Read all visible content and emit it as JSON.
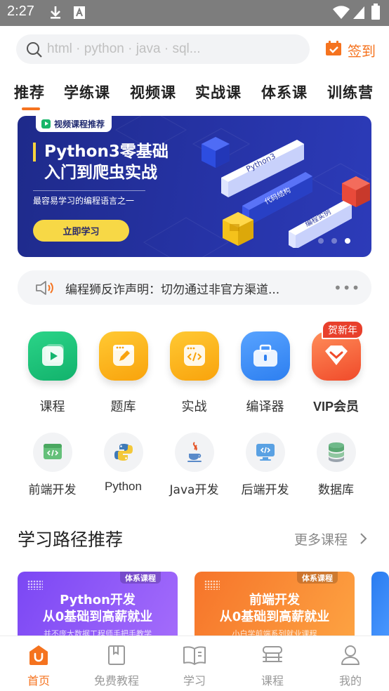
{
  "status_bar": {
    "time": "2:27",
    "icons": [
      "download-icon",
      "text-a-icon",
      "wifi-icon",
      "signal-icon",
      "battery-icon"
    ]
  },
  "search": {
    "placeholder": "html · python · java · sql..."
  },
  "checkin": {
    "label": "签到",
    "icon": "calendar-check-icon"
  },
  "tabs": [
    {
      "label": "推荐",
      "active": true
    },
    {
      "label": "学练课"
    },
    {
      "label": "视频课"
    },
    {
      "label": "实战课"
    },
    {
      "label": "体系课"
    },
    {
      "label": "训练营"
    }
  ],
  "banner": {
    "ribbon": "视频课程推荐",
    "title_line1": "Python3零基础",
    "title_line2": "入门到爬虫实战",
    "subtitle": "最容易学习的编程语言之一",
    "cta": "立即学习",
    "art_labels": [
      "Python3",
      "代码结构",
      "编程实例"
    ],
    "page_count": 3,
    "active_page": 3
  },
  "notice": {
    "text": "编程狮反诈声明：切勿通过非官方渠道...",
    "more": "•••"
  },
  "main_entries": [
    {
      "label": "课程",
      "icon": "course-play-icon",
      "color": "#19c07a"
    },
    {
      "label": "题库",
      "icon": "question-bank-icon",
      "color": "#fcb21a"
    },
    {
      "label": "实战",
      "icon": "code-practice-icon",
      "color": "#fcb21a"
    },
    {
      "label": "编译器",
      "icon": "compiler-toolbox-icon",
      "color": "#3a8cf6"
    },
    {
      "label": "VIP会员",
      "icon": "vip-heart-icon",
      "color": "#f5583a"
    }
  ],
  "vip_badge": "贺新年",
  "categories": [
    {
      "label": "前端开发",
      "icon": "frontend-code-icon"
    },
    {
      "label": "Python",
      "icon": "python-logo-icon"
    },
    {
      "label": "Java开发",
      "icon": "java-cup-icon"
    },
    {
      "label": "后端开发",
      "icon": "backend-monitor-icon"
    },
    {
      "label": "数据库",
      "icon": "database-icon"
    }
  ],
  "learning_paths": {
    "title": "学习路径推荐",
    "more": "更多课程",
    "cards": [
      {
        "tag": "体系课程",
        "line1": "Python开发",
        "line2": "从0基础到高薪就业",
        "line3": "并不庞大数据工程师手把手教学",
        "color_from": "#7c4df5",
        "color_to": "#a06bfa"
      },
      {
        "tag": "体系课程",
        "line1": "前端开发",
        "line2": "从0基础到高薪就业",
        "line3": "小白学前端系列就业课程",
        "color_from": "#f7792a",
        "color_to": "#fca040"
      }
    ]
  },
  "bottom_nav": [
    {
      "label": "首页",
      "icon": "home-icon",
      "active": true
    },
    {
      "label": "免费教程",
      "icon": "bookmark-icon"
    },
    {
      "label": "学习",
      "icon": "open-book-icon"
    },
    {
      "label": "课程",
      "icon": "stack-icon"
    },
    {
      "label": "我的",
      "icon": "user-icon"
    }
  ],
  "colors": {
    "accent": "#f5731f",
    "banner_bg": "#2633a6",
    "badge": "#e8402c"
  }
}
